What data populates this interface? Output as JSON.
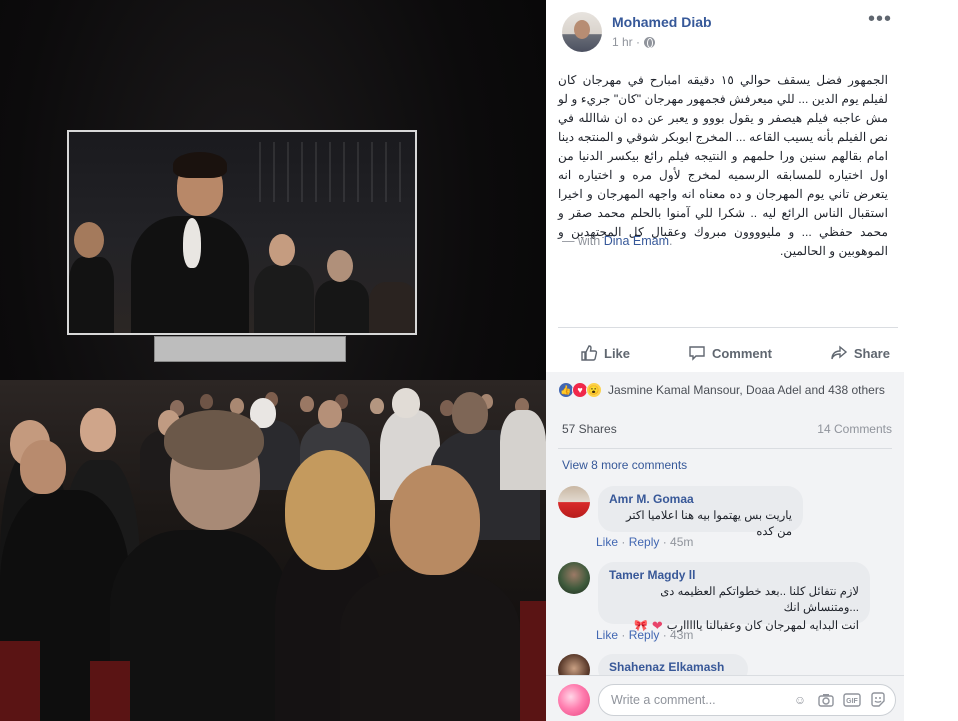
{
  "post": {
    "author": "Mohamed Diab",
    "time": "1 hr ·",
    "text": "الجمهور فضل يسقف حوالي ١٥ دقيقه امبارح في مهرجان كان لفيلم يوم الدين ... للي ميعرفش فجمهور مهرجان \"كان\" جريء و لو مش عاجبه فيلم هيصفر و يقول بووو و يعبر عن ده ان شاالله في نص الفيلم بأنه يسيب القاعه ... المخرج ابوبكر شوقي و المنتجه دينا امام بقالهم سنين ورا حلمهم و النتيجه فيلم رائع بيكسر الدنيا من اول اختياره للمسابقه الرسميه لمخرج لأول مره و اختياره انه يتعرض تاني يوم المهرجان و ده معناه انه واجهه المهرجان و اخيرا استقبال الناس الرائع ليه .. شكرا للي آمنوا بالحلم محمد صقر و محمد حفظي ... و مليوووون مبروك وعقبال كل المجتهدين و الموهوبين و الحالمين.",
    "with_prefix": "— with ",
    "with_name": "Dina Emam",
    "with_suffix": "."
  },
  "actions": {
    "like": "Like",
    "comment": "Comment",
    "share": "Share"
  },
  "reactions": {
    "names": "Jasmine Kamal Mansour, Doaa Adel and 438 others",
    "shares": "57 Shares",
    "comments_count": "14 Comments",
    "view_more": "View 8 more comments"
  },
  "comments": [
    {
      "name": "Amr M. Gomaa",
      "text": "ياريت بس يهتموا بيه هنا اعلاميا اكتر من كده",
      "like": "Like",
      "reply": "Reply",
      "time": "45m"
    },
    {
      "name": "Tamer Magdy ll",
      "text_line1": "لازم نتفائل كلنا ..بعد خطواتكم العظيمه دى ...ومتنساش انك",
      "text_line2": "انت البدايه لمهرجان كان وعقبالنا يااااارب",
      "like": "Like",
      "reply": "Reply",
      "time": "43m"
    },
    {
      "name": "Shahenaz Elkamash"
    }
  ],
  "composer": {
    "placeholder": "Write a comment..."
  },
  "colors": {
    "link": "#365899",
    "like_reaction": "#4267b2",
    "love_reaction": "#f0284a",
    "wow_reaction": "#fcd24a"
  }
}
